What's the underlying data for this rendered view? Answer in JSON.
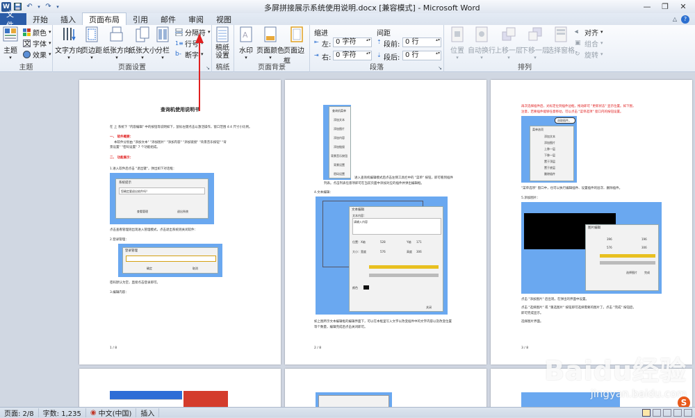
{
  "window": {
    "title": "多屏拼接展示系统使用说明.docx [兼容模式] - Microsoft Word",
    "app_icon": "W"
  },
  "tabs": [
    "文件",
    "开始",
    "插入",
    "页面布局",
    "引用",
    "邮件",
    "审阅",
    "视图"
  ],
  "active_tab": "页面布局",
  "ribbon": {
    "themes": {
      "label": "主题",
      "theme": "主题",
      "colors": "颜色",
      "fonts": "字体",
      "effects": "效果"
    },
    "page_setup": {
      "label": "页面设置",
      "text_direction": "文字方向",
      "margins": "页边距",
      "orientation": "纸张方向",
      "size": "纸张大小",
      "columns": "分栏",
      "breaks": "分隔符",
      "line_numbers": "行号",
      "hyphenation": "断字"
    },
    "manuscript": {
      "label": "稿纸",
      "button": "稿纸\n设置"
    },
    "page_background": {
      "label": "页面背景",
      "watermark": "水印",
      "page_color": "页面颜色",
      "page_borders": "页面边框"
    },
    "paragraph": {
      "label": "段落",
      "indent_title": "缩进",
      "spacing_title": "间距",
      "left_label": "左:",
      "left_value": "0 字符",
      "right_label": "右:",
      "right_value": "0 字符",
      "before_label": "段前:",
      "before_value": "0 行",
      "after_label": "段后:",
      "after_value": "0 行"
    },
    "arrange": {
      "label": "排列",
      "position": "位置",
      "wrap_text": "自动换行",
      "bring_forward": "上移一层",
      "send_backward": "下移一层",
      "selection_pane": "选择窗格",
      "align": "对齐",
      "group": "组合",
      "rotate": "旋转"
    }
  },
  "document": {
    "page1": {
      "heading": "查询机使用说明书",
      "line1": "在 上 系统下 \"内容编辑\" 中的按钮等说明如下，鼠标左键点击以激活操作，窗口范围 4:4 尺寸小比例。",
      "sec1": "一、 软件概要：",
      "sec1_body1": "本软件分别由 \"添加文本\" \"添加图片\" \"添加内容\" \"添加链接\" \"背景音乐按钮\" \"背",
      "sec1_body2": "景设置\" \"密码设置\" 7 个功能组成。",
      "sec2": "二、 功能展示：",
      "step1": "1.进入软件后点击 \"退出键\"，弹出如下对话框：",
      "dialog_title": "系统提示",
      "dialog_msg": "您确定要退出软件吗？",
      "dialog_ok": "查看管理",
      "dialog_cancel": "退出系统",
      "after_dialog": "点击查看管理则出现进入管理模式，点击退出系统则关闭软件：",
      "step2": "2.登录管理：",
      "login_title": "登录管理",
      "login_ok": "确定",
      "login_cancel": "取消",
      "after_login": "密码默认为空，直接点击登录即可。",
      "step3": "3.编辑内容：",
      "page_no": "1 / 8"
    },
    "page2": {
      "menu_items": [
        "查询机菜单",
        "添加文本",
        "添加图片",
        "添加内容",
        "添加链接",
        "背景音乐按钮",
        "背景设置",
        "密码设置"
      ],
      "after_menu1": "进入查询机编辑模式后点击左侧工具栏中的 \"菜单\" 按钮，即可看到插件",
      "after_menu2": "列表。点击列表任意项即可在当前页面中添加对应的插件并弹出编辑框。",
      "step4": "4.文本编辑：",
      "editor_title": "文本编辑",
      "editor_label": "文本内容：",
      "editor_text": "请输入内容",
      "pos_label": "位置：X轴",
      "pos_x": "528",
      "pos_y_label": "Y轴",
      "pos_y": "171",
      "size_label": "大小：宽度",
      "size_w": "576",
      "size_h_label": "高度",
      "size_h": "306",
      "font_label": "颜色",
      "close_btn": "关闭",
      "after_editor1": "如上图所示文本编辑框的编辑界面下，可以在本框里写入文字以改变插件中的文字内容以及改变位置",
      "after_editor2": "等个数量，编辑完成后点击关闭即可。",
      "page_no": "2 / 8"
    },
    "page3": {
      "red1": "再次选择插件后，光标定位到插件边框，拖动即可 \"更新状态\" 显示位置。如下图，",
      "red2": "注意，若要插件能够任意移动，可以点击 \"菜单选项\" 窗口内的按钮设置。",
      "callout": "选取插件。",
      "menu_title": "菜单选项",
      "menu_items": [
        "添加文本",
        "添加图片",
        "上移一层",
        "下移一层",
        "置于顶层",
        "置于底层",
        "删除插件"
      ],
      "after_menu": "\"菜单选项\" 窗口中，也可以执行编辑插件、设置插件的层次、删除插件。",
      "step5": "5.添加图片：",
      "img_editor_title": "图片编辑",
      "img_x": "396",
      "img_y": "196",
      "img_w": "576",
      "img_h": "306",
      "img_browse": "选择图片",
      "img_ok": "完成",
      "after_img1": "点击 \"添加图片\" 后出现，在弹出的界面中设置。",
      "after_img2": "点击 \"选择图片\" 或 \"重选图片\" 按钮即可选择需要的图片了。点击 \"完成\" 按钮后，",
      "after_img3": "即可完成显示。",
      "after_img4": "选择图片界面。",
      "page_no": "3 / 8"
    }
  },
  "status": {
    "page": "页面: 2/8",
    "words": "字数: 1,235",
    "language": "中文(中国)",
    "mode": "插入"
  },
  "watermark": {
    "brand": "Baidu经验",
    "url": "jingyan.baidu.com"
  },
  "colors": {
    "file_tab": "#2b5ca8",
    "shot_blue": "#6aa8f0",
    "red_text": "#e02020",
    "arrow": "#e02020"
  }
}
